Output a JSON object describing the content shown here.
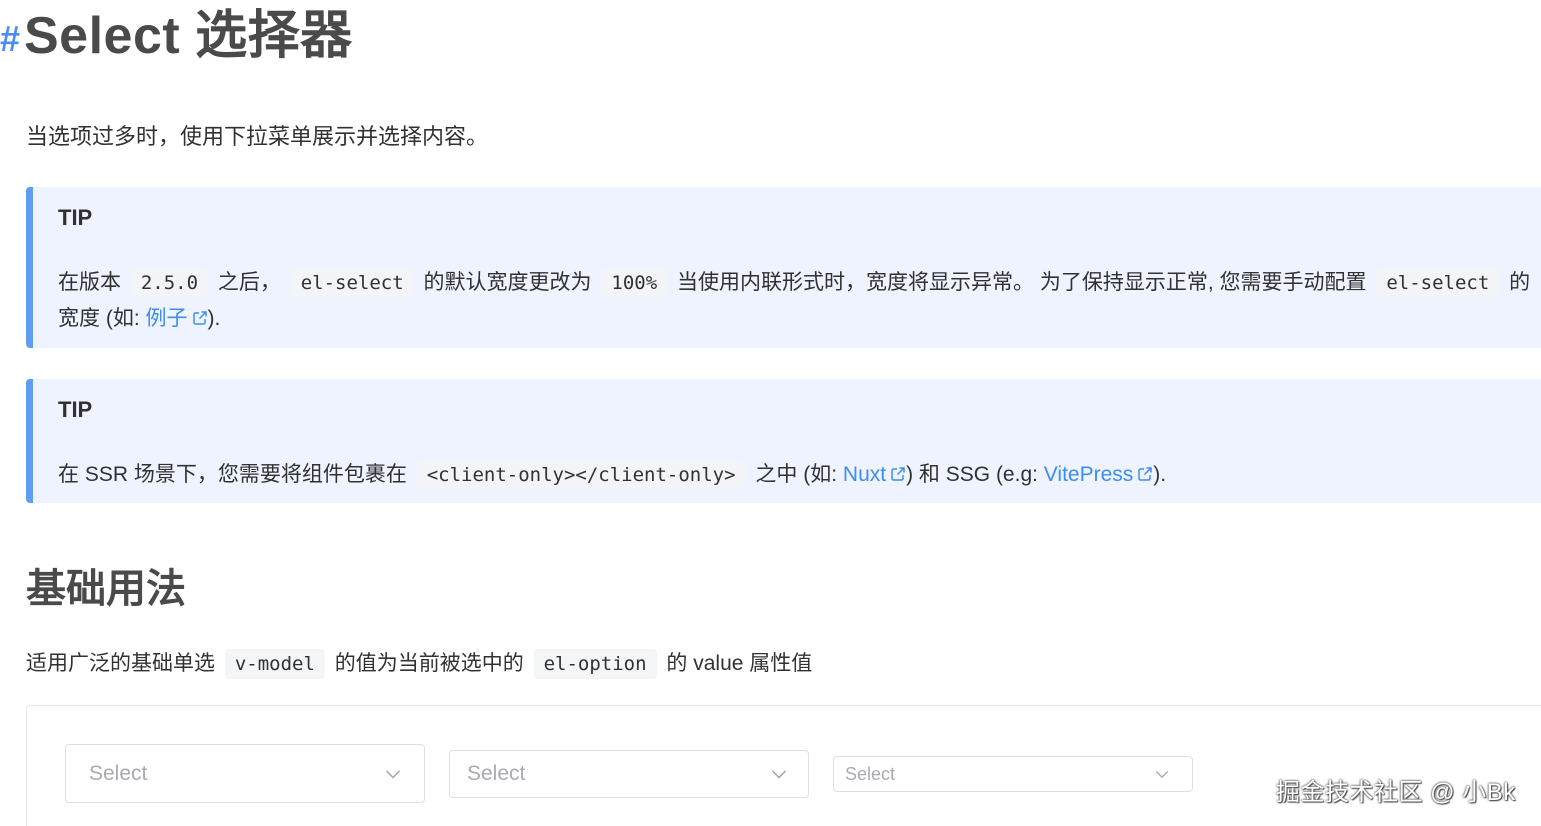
{
  "page": {
    "anchor": "#",
    "title": "Select 选择器",
    "description": "当选项过多时，使用下拉菜单展示并选择内容。"
  },
  "tip1": {
    "title": "TIP",
    "t1": "在版本",
    "code1": "2.5.0",
    "t2": "之后，",
    "code2": "el-select",
    "t3": "的默认宽度更改为",
    "code3": "100%",
    "t4": "当使用内联形式时，宽度将显示异常。 为了保持显示正常, 您需要手动配置",
    "code4": "el-select",
    "t5": "的",
    "t6": "宽度 (如: ",
    "link": "例子",
    "t7": ")."
  },
  "tip2": {
    "title": "TIP",
    "t1": "在 SSR 场景下，您需要将组件包裹在",
    "code1": "<client-only></client-only>",
    "t2": "之中 (如: ",
    "link1": "Nuxt",
    "t3": ") 和 SSG (e.g: ",
    "link2": "VitePress",
    "t4": ")."
  },
  "basic": {
    "heading": "基础用法",
    "t1": "适用广泛的基础单选",
    "code1": "v-model",
    "t2": "的值为当前被选中的",
    "code2": "el-option",
    "t3": "的 value 属性值"
  },
  "demo": {
    "select_large": "Select",
    "select_default": "Select",
    "select_small": "Select"
  },
  "watermark": "掘金技术社区 @ 小Bk",
  "icons": {
    "external": "external-link-icon",
    "chevron": "chevron-down-icon"
  },
  "colors": {
    "accent": "#3d8cf0",
    "tip_border": "#5f9cf4",
    "tip_background": "#eef3ff"
  }
}
